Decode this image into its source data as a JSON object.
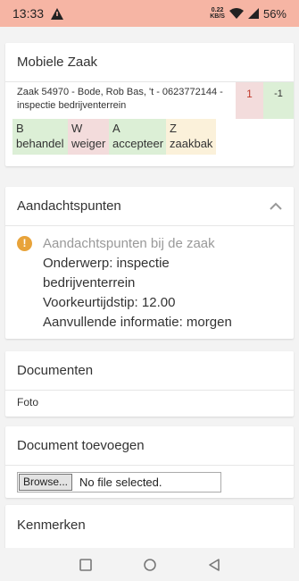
{
  "status_bar": {
    "time": "13:33",
    "data_rate_value": "0.22",
    "data_rate_unit": "KB/S",
    "battery": "56%"
  },
  "zaak_card": {
    "title": "Mobiele Zaak",
    "line1": "Zaak 54970 - Bode, Rob Bas, 't - 0623772144 -",
    "line2": "inspectie bedrijventerrein",
    "count_red": "1",
    "count_green": "-1",
    "actions": [
      {
        "key": "B",
        "label": "behandel"
      },
      {
        "key": "W",
        "label": "weiger"
      },
      {
        "key": "A",
        "label": "accepteer"
      },
      {
        "key": "Z",
        "label": "zaakbak"
      }
    ]
  },
  "aandacht_card": {
    "title": "Aandachtspunten",
    "icon_glyph": "!",
    "heading": "Aandachtspunten bij de zaak",
    "lines": [
      "Onderwerp: inspectie",
      "bedrijventerrein",
      "Voorkeurtijdstip: 12.00",
      "Aanvullende informatie: morgen"
    ]
  },
  "documenten_card": {
    "title": "Documenten",
    "items": [
      "Foto"
    ]
  },
  "toevoegen_card": {
    "title": "Document toevoegen",
    "browse_label": "Browse...",
    "file_status": "No file selected."
  },
  "kenmerken_card": {
    "title": "Kenmerken"
  },
  "colors": {
    "status_bar": "#f6b5a4",
    "green_cell": "#dcefd6",
    "red_cell": "#f3dcdc",
    "yellow_cell": "#fbf1da",
    "warning_icon": "#e8a33a"
  }
}
